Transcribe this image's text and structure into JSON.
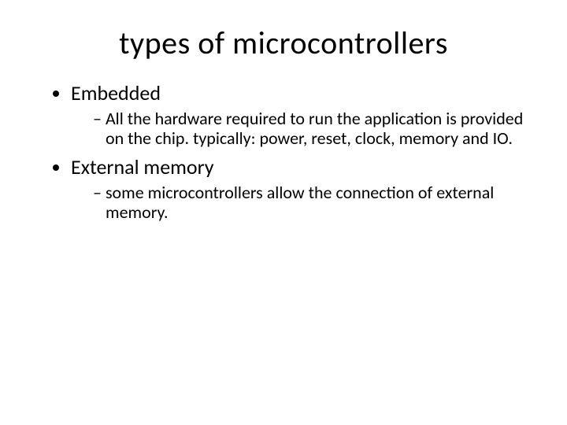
{
  "title": "types of microcontrollers",
  "bullets": [
    {
      "label": "Embedded",
      "sub": [
        "All the hardware required to run the application is provided on the chip. typically: power, reset, clock, memory and IO."
      ]
    },
    {
      "label": "External memory",
      "sub": [
        "some microcontrollers allow the connection of external memory."
      ]
    }
  ]
}
